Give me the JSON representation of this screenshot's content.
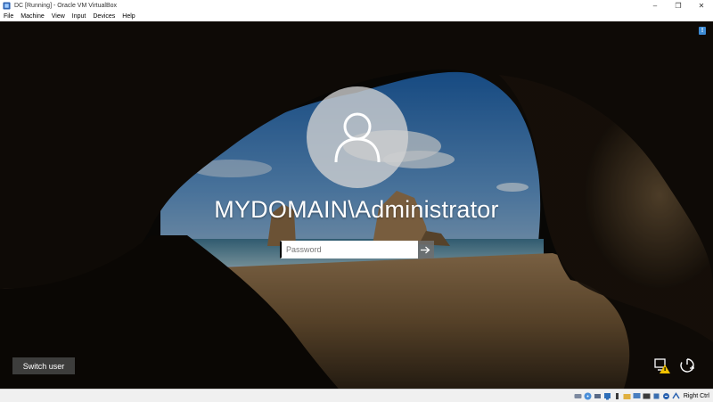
{
  "window": {
    "title": "DC [Running] - Oracle VM VirtualBox",
    "controls": {
      "minimize": "–",
      "maximize": "❐",
      "close": "✕"
    }
  },
  "menubar": {
    "items": [
      "File",
      "Machine",
      "View",
      "Input",
      "Devices",
      "Help"
    ]
  },
  "login": {
    "username": "MYDOMAIN\\Administrator",
    "password_placeholder": "Password",
    "password_value": "",
    "switch_user_label": "Switch user",
    "info_badge": "!"
  },
  "statusbar": {
    "host_key_label": "Right Ctrl",
    "icons": [
      "hard-disk-icon",
      "optical-drive-icon",
      "audio-icon",
      "network-icon",
      "usb-icon",
      "shared-folders-icon",
      "display-icon",
      "video-capture-icon",
      "cpu-icon",
      "mouse-integration-icon",
      "host-key-icon"
    ]
  },
  "colors": {
    "accent": "#3d8bd4",
    "avatar_bg": "#d2d2d2",
    "submit_bg": "#6e6e6e",
    "switch_user_bg": "#464646"
  }
}
